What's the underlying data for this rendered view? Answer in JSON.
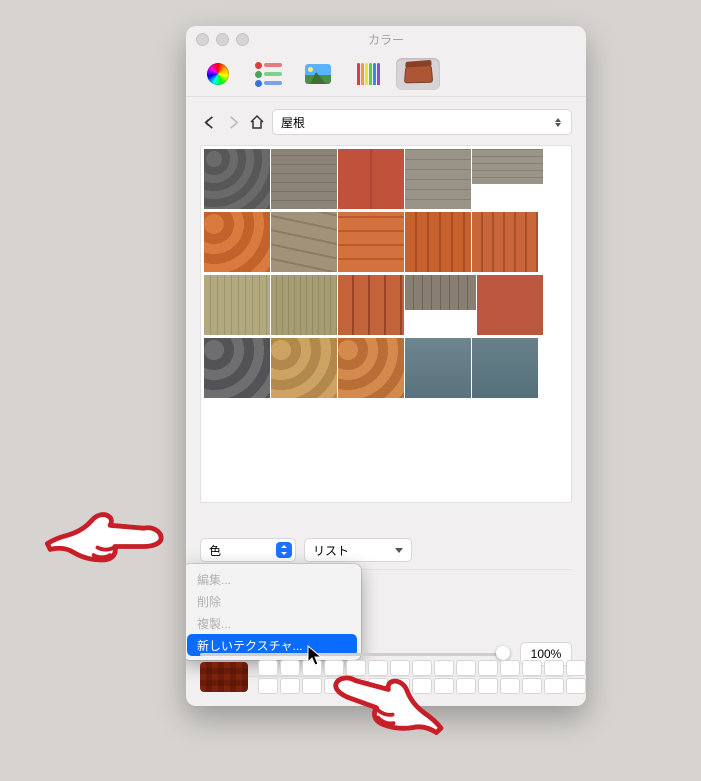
{
  "window": {
    "title": "カラー"
  },
  "nav": {
    "category": "屋根"
  },
  "controls": {
    "color_label": "色",
    "view_label": "リスト",
    "opacity_value": "100%"
  },
  "menu": {
    "items": [
      {
        "label": "編集...",
        "enabled": false
      },
      {
        "label": "削除",
        "enabled": false
      },
      {
        "label": "複製...",
        "enabled": false
      },
      {
        "label": "新しいテクスチャ...",
        "enabled": true,
        "highlighted": true
      }
    ]
  },
  "toolbar": {
    "modes": [
      "color-wheel",
      "sliders",
      "image",
      "pencils",
      "textures"
    ],
    "selected": "textures"
  },
  "swatch_colors": {
    "pencils": [
      "#e23b3b",
      "#e8a23a",
      "#efe23a",
      "#63c94a",
      "#3a88e2",
      "#8b4ed0"
    ],
    "slider_icons": [
      {
        "dot": "#e23b3b",
        "bar": "#e67b7b"
      },
      {
        "dot": "#4aa35a",
        "bar": "#7cd18b"
      },
      {
        "dot": "#3a70d8",
        "bar": "#7aa2e8"
      }
    ]
  },
  "textures": [
    [
      {
        "id": "roof-slate-scallop",
        "bg": "repeating-radial-gradient(circle at 10px 10px,#6a6a6a 0 8px,#575757 8px 16px),#6d6d6d"
      },
      {
        "id": "roof-asphalt-grey",
        "bg": "repeating-linear-gradient(0deg,#8c8378 0 8px,#7a7166 8px 9px)"
      },
      {
        "id": "roof-metal-red",
        "bg": "linear-gradient(90deg,#c0523c 48%,#9b3e2c 50%,#c0523c 52%)"
      },
      {
        "id": "roof-shingle-grey",
        "bg": "repeating-linear-gradient(0deg,#9a9388 0 9px,#857e73 9px 10px)"
      },
      {
        "id": "roof-asphalt-strip",
        "bg": "repeating-linear-gradient(0deg,#9b9489 0 6px,#877f74 6px 7px)",
        "half": true
      }
    ],
    [
      {
        "id": "roof-scallop-orange",
        "bg": "repeating-radial-gradient(circle at 10px 12px,#d97a3e 0 10px,#c3622b 10px 20px)"
      },
      {
        "id": "roof-asphalt-tan",
        "bg": "repeating-linear-gradient(12deg,#a2927a 0 12px,#8b7c66 12px 14px)"
      },
      {
        "id": "roof-clay-pan",
        "bg": "repeating-linear-gradient(0deg,#d3713f 0 12px,#b85a2d 12px 14px)"
      },
      {
        "id": "roof-spanish-tile",
        "bg": "repeating-linear-gradient(90deg,#c7622f 0 10px,#a94d23 10px 12px),repeating-linear-gradient(0deg,transparent 0 20px,#8a3b19 20px 22px)"
      },
      {
        "id": "roof-spanish-tile-2",
        "bg": "repeating-linear-gradient(90deg,#c9663a 0 9px,#aa4f29 9px 11px)"
      }
    ],
    [
      {
        "id": "roof-wood-shake-1",
        "bg": "repeating-linear-gradient(90deg,#b2a97e 0 6px,#9d946a 6px 7px),repeating-linear-gradient(0deg,transparent 0 18px,#857c55 18px 20px)"
      },
      {
        "id": "roof-wood-shake-2",
        "bg": "repeating-linear-gradient(90deg,#a79d72 0 5px,#938a60 5px 6px)"
      },
      {
        "id": "roof-barrel-terracotta",
        "bg": "repeating-linear-gradient(90deg,#c2633a 0 14px,#9c4526 14px 16px),repeating-linear-gradient(0deg,transparent 0 16px,#7e371e 16px 18px)"
      },
      {
        "id": "roof-metal-rib",
        "bg": "repeating-linear-gradient(90deg,#887e72 0 8px,#6e6459 8px 9px)",
        "half": true
      },
      {
        "id": "roof-flat-red",
        "bg": "#bb573f"
      }
    ],
    [
      {
        "id": "roof-slate-dark",
        "bg": "repeating-radial-gradient(circle at 10px 12px,#6e6e70 0 10px,#535357 10px 20px)"
      },
      {
        "id": "roof-scale-tan",
        "bg": "repeating-radial-gradient(circle at 10px 12px,#cda263 0 10px,#b3884c 10px 20px)"
      },
      {
        "id": "roof-scale-orange",
        "bg": "repeating-radial-gradient(circle at 10px 12px,#d48a4c 0 10px,#b86e36 10px 20px)"
      },
      {
        "id": "roof-metal-blue-1",
        "bg": "linear-gradient(#6e8690,#5a727c)"
      },
      {
        "id": "roof-metal-blue-2",
        "bg": "linear-gradient(#68808a,#54707a)"
      }
    ]
  ]
}
